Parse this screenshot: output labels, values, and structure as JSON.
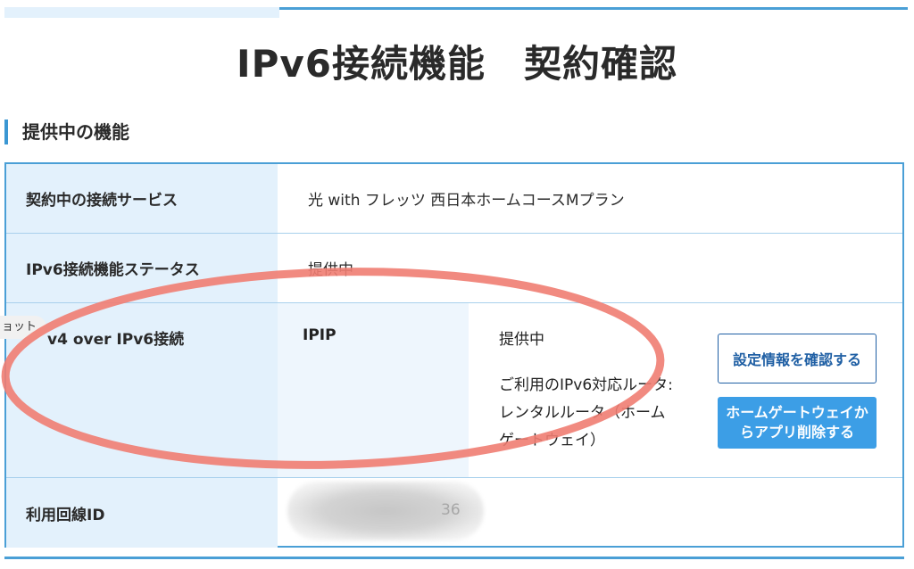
{
  "page": {
    "title": "IPv6接続機能　契約確認"
  },
  "section": {
    "heading": "提供中の機能"
  },
  "rows": [
    {
      "label": "契約中の接続サービス",
      "value": "光 with フレッツ 西日本ホームコースMプラン"
    },
    {
      "label": "IPv6接続機能ステータス",
      "value": "提供中"
    },
    {
      "label": "v4 over IPv6接続",
      "type": "IPIP",
      "status": "提供中",
      "router_text": "ご利用のIPv6対応ルータ: レンタルルータ（ホームゲートウェイ）",
      "router_lines": [
        "ご利用のIPv6対応ルータ:",
        "レンタルルータ（ホーム",
        "ゲートウェイ）"
      ],
      "buttons": {
        "confirm_settings": "設定情報を確認する",
        "delete_app": "ホームゲートウェイからアプリ削除する"
      }
    },
    {
      "label": "利用回線ID",
      "value_visible_tail": "36"
    }
  ],
  "tooltip": {
    "text": "ョット"
  },
  "colors": {
    "frame": "#4a9fd6",
    "label_bg": "#e3f1fc",
    "button_outline": "#1f5fa4",
    "button_fill": "#3c9ee6",
    "annotation": "#f07d72"
  },
  "icons": {
    "annotation": "red-ellipse-annotation"
  }
}
